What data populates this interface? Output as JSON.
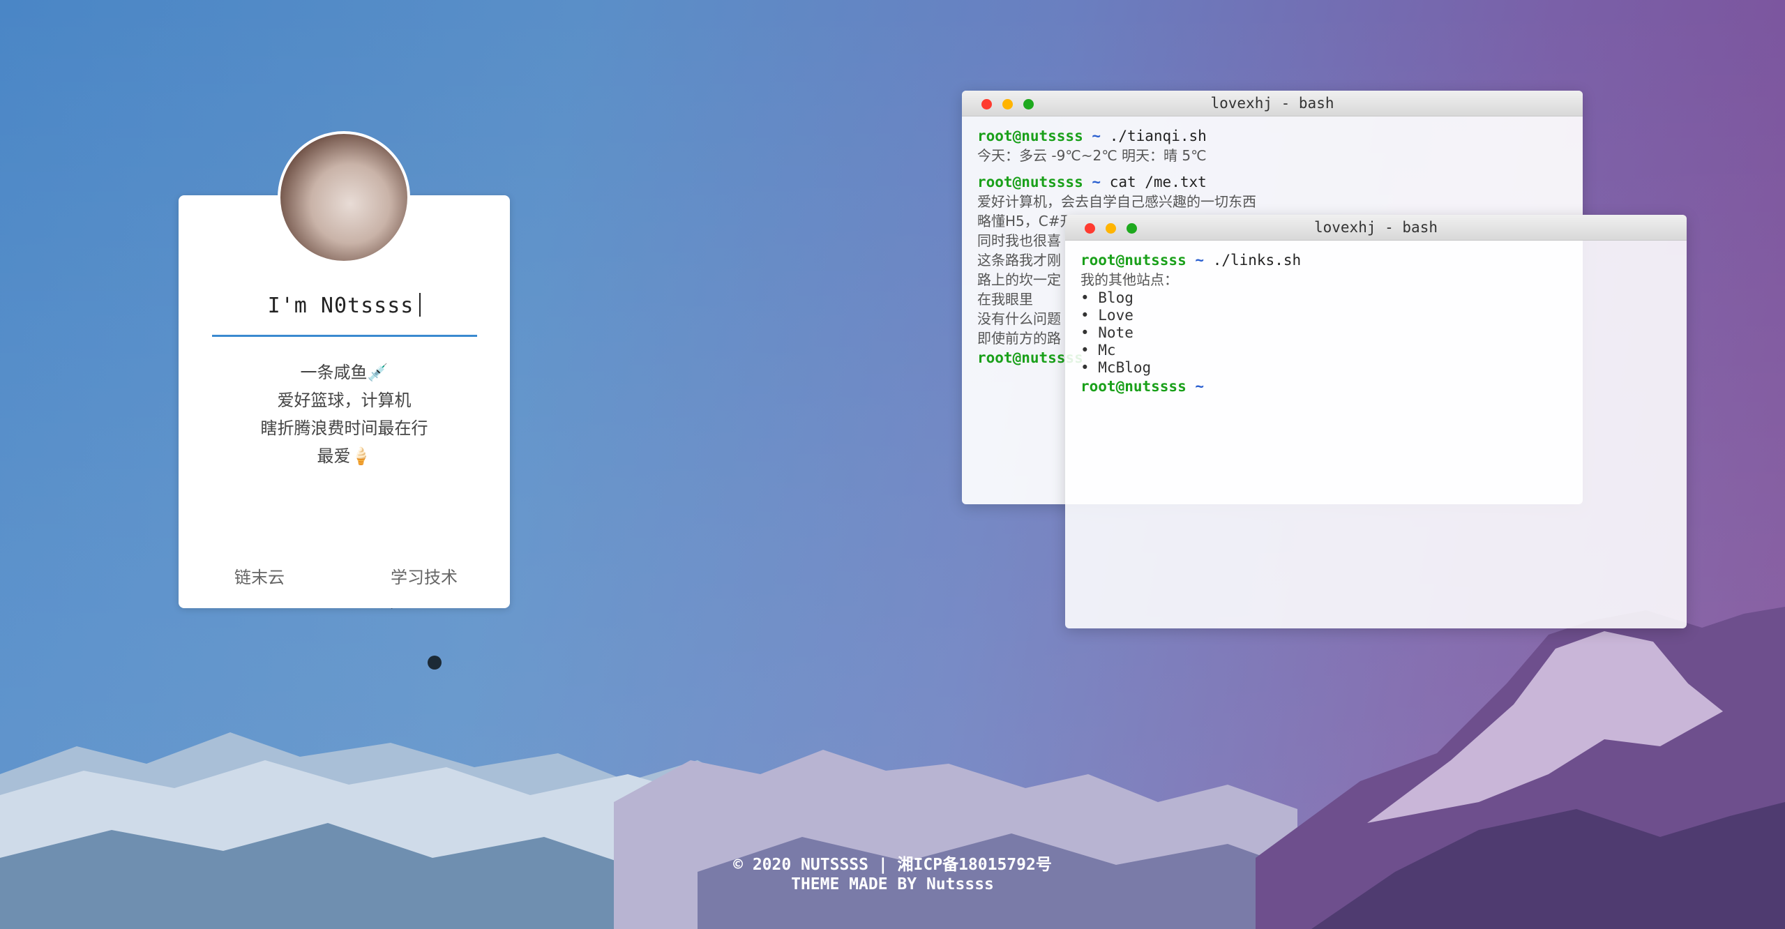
{
  "profile": {
    "title": "I'm N0tssss",
    "bio": [
      "一条咸鱼💉",
      "爱好篮球，计算机",
      "瞎折腾浪费时间最在行",
      "最爱🍦"
    ],
    "links": [
      {
        "label": "链末云"
      },
      {
        "label": "学习技术"
      }
    ]
  },
  "terminal_main": {
    "title": "lovexhj - bash",
    "blocks": [
      {
        "user": "root@nutssss",
        "tilde": "~",
        "cmd": "./tianqi.sh",
        "output": [
          "今天：多云 -9℃~2℃ 明天：晴 5℃"
        ]
      },
      {
        "user": "root@nutssss",
        "tilde": "~",
        "cmd": "cat /me.txt",
        "output": [
          "爱好计算机，会去自学自己感兴趣的一切东西",
          "略懂H5，C#开",
          "同时我也很喜",
          "这条路我才刚",
          "路上的坎一定",
          "在我眼里",
          "没有什么问题",
          "即使前方的路"
        ]
      },
      {
        "user": "root@nutssss",
        "tilde": "",
        "cmd": "",
        "output": []
      }
    ]
  },
  "terminal_links": {
    "title": "lovexhj - bash",
    "user": "root@nutssss",
    "tilde": "~",
    "cmd": "./links.sh",
    "heading": "我的其他站点：",
    "items": [
      "• Blog",
      "• Love",
      "• Note",
      "• Mc",
      "• McBlog"
    ]
  },
  "footer": {
    "line1": "© 2020 NUTSSSS | 湘ICP备18015792号",
    "line2": "THEME MADE BY Nutssss"
  },
  "colors": {
    "prompt_user": "#1aa01a",
    "prompt_tilde": "#2a5fd0",
    "divider": "#3a8ad0"
  }
}
